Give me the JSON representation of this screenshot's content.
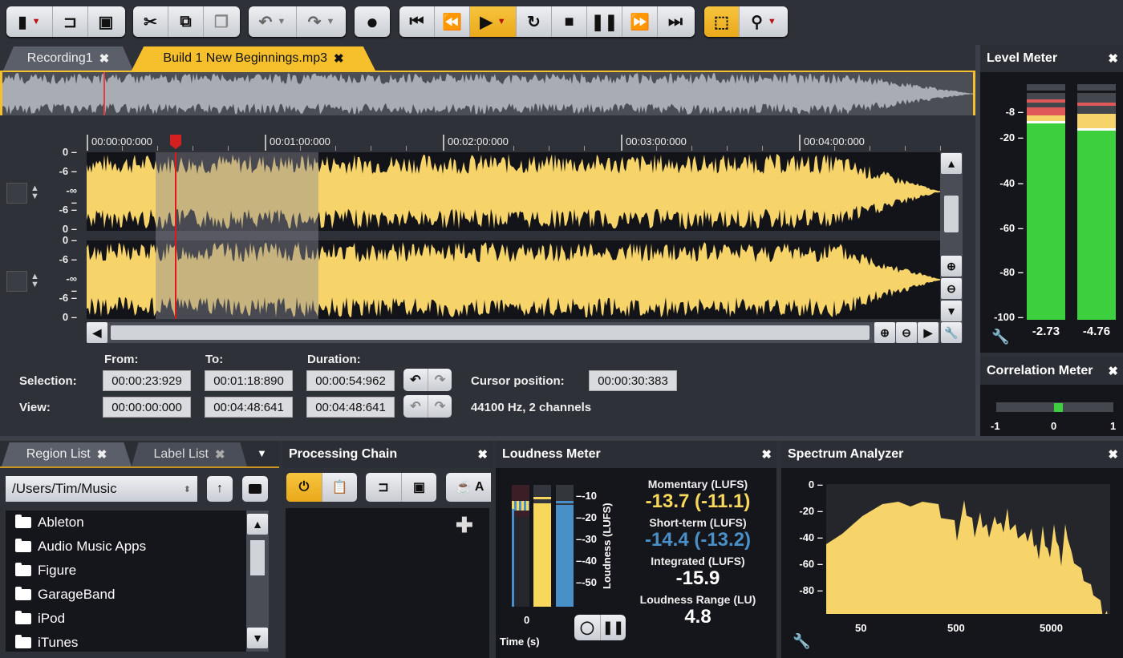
{
  "toolbar": {
    "groups": [
      {
        "name": "file",
        "buttons": [
          {
            "icon": "new-file-icon",
            "glyph": "▙",
            "dropdown": true
          },
          {
            "icon": "open-folder-icon",
            "glyph": "📂"
          },
          {
            "icon": "save-icon",
            "glyph": "💾"
          }
        ]
      },
      {
        "name": "edit",
        "buttons": [
          {
            "icon": "cut-icon",
            "glyph": "✂"
          },
          {
            "icon": "copy-icon",
            "glyph": "⧉"
          },
          {
            "icon": "paste-icon",
            "glyph": "📋"
          }
        ]
      },
      {
        "name": "history",
        "buttons": [
          {
            "icon": "undo-icon",
            "glyph": "↶"
          },
          {
            "icon": "redo-icon",
            "glyph": "↷"
          }
        ]
      },
      {
        "name": "record",
        "buttons": [
          {
            "icon": "record-icon",
            "glyph": "●"
          }
        ]
      },
      {
        "name": "transport",
        "buttons": [
          {
            "icon": "skip-to-start-icon",
            "glyph": "⏮"
          },
          {
            "icon": "rewind-icon",
            "glyph": "⏪"
          },
          {
            "icon": "play-icon",
            "glyph": "▶",
            "active": true,
            "dropdown": true
          },
          {
            "icon": "loop-icon",
            "glyph": "↻"
          },
          {
            "icon": "stop-icon",
            "glyph": "■"
          },
          {
            "icon": "pause-icon",
            "glyph": "❚❚"
          },
          {
            "icon": "fast-forward-icon",
            "glyph": "⏩"
          },
          {
            "icon": "skip-to-end-icon",
            "glyph": "⏭"
          }
        ]
      },
      {
        "name": "tools",
        "buttons": [
          {
            "icon": "selection-tool-icon",
            "glyph": "⬚",
            "active": true
          },
          {
            "icon": "zoom-tool-icon",
            "glyph": "⚲",
            "dropdown": true
          }
        ]
      }
    ]
  },
  "tabs": [
    {
      "label": "Recording1",
      "active": false
    },
    {
      "label": "Build 1 New Beginnings.mp3",
      "active": true
    }
  ],
  "timeline": {
    "ticks": [
      "00:00:00:000",
      "00:01:00:000",
      "00:02:00:000",
      "00:03:00:000",
      "00:04:00:000"
    ],
    "channel_ylabels": [
      "0",
      "-6",
      "-∞",
      "-6",
      "0"
    ]
  },
  "selection_info": {
    "col_headers": {
      "from": "From:",
      "to": "To:",
      "duration": "Duration:"
    },
    "selection": {
      "label": "Selection:",
      "from": "00:00:23:929",
      "to": "00:01:18:890",
      "duration": "00:00:54:962"
    },
    "view": {
      "label": "View:",
      "from": "00:00:00:000",
      "to": "00:04:48:641",
      "duration": "00:04:48:641"
    },
    "cursor_label": "Cursor position:",
    "cursor_value": "00:00:30:383",
    "format": "44100 Hz, 2 channels"
  },
  "level_meter": {
    "title": "Level Meter",
    "scale": [
      "-8",
      "-20",
      "-40",
      "-60",
      "-80",
      "-100"
    ],
    "left_value": "-2.73",
    "right_value": "-4.76"
  },
  "correlation_meter": {
    "title": "Correlation Meter",
    "scale": [
      "-1",
      "0",
      "1"
    ],
    "value": 0.05
  },
  "bottom_tabs": [
    {
      "label": "Region List",
      "active": true
    },
    {
      "label": "Label List",
      "active": false
    }
  ],
  "file_browser": {
    "path": "/Users/Tim/Music",
    "items": [
      "Ableton",
      "Audio Music Apps",
      "Figure",
      "GarageBand",
      "iPod",
      "iTunes"
    ]
  },
  "processing_chain": {
    "title": "Processing Chain",
    "partial_label": "A"
  },
  "loudness_meter": {
    "title": "Loudness Meter",
    "scale": [
      "-10",
      "-20",
      "-30",
      "-40",
      "-50"
    ],
    "axis_label": "Loudness (LUFS)",
    "time_label": "Time (s)",
    "time_tick": "0",
    "momentary_label": "Momentary (LUFS)",
    "momentary_value": "-13.7 (-11.1)",
    "shortterm_label": "Short-term (LUFS)",
    "shortterm_value": "-14.4 (-13.2)",
    "integrated_label": "Integrated (LUFS)",
    "integrated_value": "-15.9",
    "range_label": "Loudness Range (LU)",
    "range_value": "4.8",
    "colors": {
      "momentary": "#f7d85c",
      "shortterm": "#4a90c8"
    }
  },
  "spectrum_analyzer": {
    "title": "Spectrum Analyzer",
    "yticks": [
      "0",
      "-20",
      "-40",
      "-60",
      "-80"
    ],
    "xticks": [
      "50",
      "500",
      "5000"
    ]
  },
  "colors": {
    "accent": "#f5c02c",
    "waveform": "#f7d46a",
    "meter_green": "#3ecf3e",
    "playhead": "#d42020"
  }
}
